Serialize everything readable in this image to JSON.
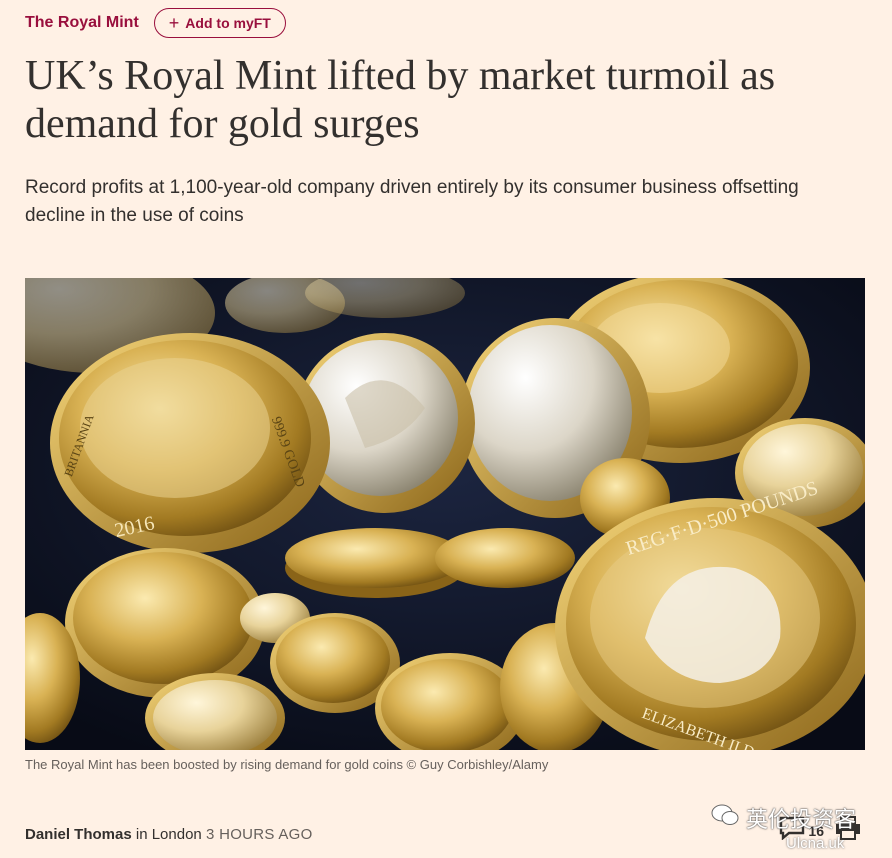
{
  "topic": {
    "label": "The Royal Mint"
  },
  "myft": {
    "plus": "+",
    "label": "Add to myFT"
  },
  "article": {
    "headline": "UK’s Royal Mint lifted by market turmoil as demand for gold surges",
    "standfirst": "Record profits at 1,100-year-old company driven entirely by its consumer business offsetting decline in the use of coins",
    "image": {
      "coin_year": "2016",
      "coin_edge_text": "999.9 GOLD",
      "coin_denomination": "REG·F·D·500 POUNDS",
      "coin_ruler": "ELIZABETH II D·G",
      "coin_inscription": "BRITANNIA"
    },
    "caption": "The Royal Mint has been boosted by rising demand for gold coins © Guy Corbishley/Alamy",
    "byline": {
      "author": "Daniel Thomas",
      "location": "in London",
      "timestamp": "3 HOURS AGO"
    },
    "comments_count": "16"
  },
  "icons": {
    "comments": "comment-icon",
    "print": "print-icon",
    "wechat": "wechat-icon"
  },
  "watermark": {
    "text": "英伦投资客",
    "sub": "Ulcna.uk"
  },
  "colors": {
    "background": "#fff1e5",
    "accent": "#990f3d",
    "text": "#33302e"
  }
}
